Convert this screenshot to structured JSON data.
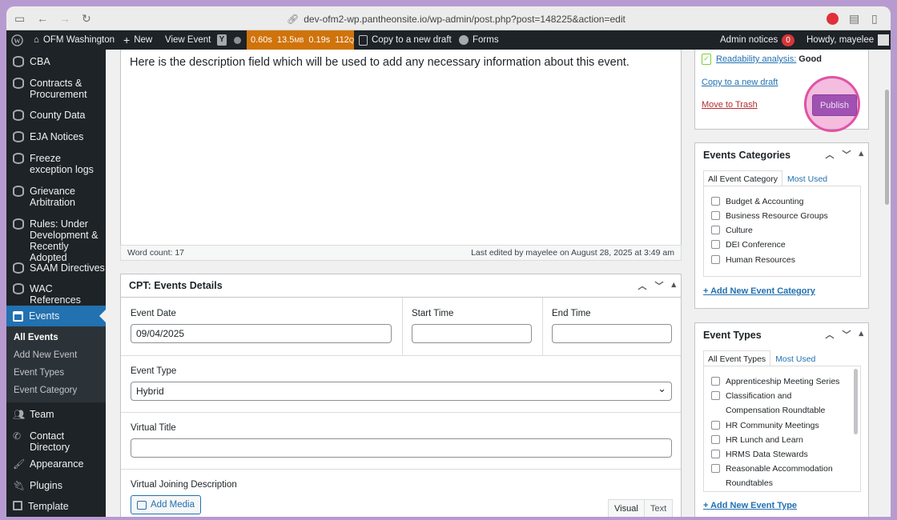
{
  "browser": {
    "url": "dev-ofm2-wp.pantheonsite.io/wp-admin/post.php?post=148225&action=edit"
  },
  "adminbar": {
    "site_name": "OFM Washington",
    "new_label": "New",
    "view_label": "View Event",
    "perf": {
      "time": "0.60s",
      "memory": "13.5",
      "memory_unit": "MB",
      "query_time": "0.19s",
      "queries": "112",
      "queries_unit": "Q"
    },
    "copy_draft": "Copy to a new draft",
    "forms": "Forms",
    "admin_notices": "Admin notices",
    "notice_count": "0",
    "howdy": "Howdy, mayelee"
  },
  "sidebar": {
    "items": [
      {
        "label": "CBA"
      },
      {
        "label": "Contracts & Procurement"
      },
      {
        "label": "County Data"
      },
      {
        "label": "EJA Notices"
      },
      {
        "label": "Freeze exception logs"
      },
      {
        "label": "Grievance Arbitration"
      },
      {
        "label": "Rules: Under Development & Recently Adopted"
      },
      {
        "label": "SAAM Directives"
      },
      {
        "label": "WAC References"
      },
      {
        "label": "Events"
      },
      {
        "label": "Team"
      },
      {
        "label": "Contact Directory"
      },
      {
        "label": "Appearance"
      },
      {
        "label": "Plugins"
      },
      {
        "label": "Template"
      }
    ],
    "submenu": [
      "All Events",
      "Add New Event",
      "Event Types",
      "Event Category"
    ]
  },
  "editor": {
    "description": "Here is the description field which will be used to add any necessary information about this event.",
    "word_count": "Word count: 17",
    "last_edited": "Last edited by mayelee on August 28, 2025 at 3:49 am"
  },
  "cpt_box": {
    "title": "CPT: Events Details",
    "event_date_label": "Event Date",
    "event_date_value": "09/04/2025",
    "start_time_label": "Start Time",
    "end_time_label": "End Time",
    "event_type_label": "Event Type",
    "event_type_value": "Hybrid",
    "virtual_title_label": "Virtual Title",
    "virtual_join_label": "Virtual Joining Description",
    "add_media": "Add Media",
    "tab_visual": "Visual",
    "tab_text": "Text"
  },
  "publish_box": {
    "readability_label": "Readability analysis:",
    "readability_value": "Good",
    "copy_draft": "Copy to a new draft",
    "trash": "Move to Trash",
    "publish": "Publish"
  },
  "categories_box": {
    "title": "Events Categories",
    "tab_all": "All Event Category",
    "tab_most": "Most Used",
    "items": [
      "Budget & Accounting",
      "Business Resource Groups",
      "Culture",
      "DEI Conference",
      "Human Resources"
    ],
    "add_new": "+ Add New Event Category"
  },
  "types_box": {
    "title": "Event Types",
    "tab_all": "All Event Types",
    "tab_most": "Most Used",
    "items": [
      "Apprenticeship Meeting Series",
      "Classification and Compensation Roundtable",
      "HR Community Meetings",
      "HR Lunch and Learn",
      "HRMS Data Stewards",
      "Reasonable Accommodation Roundtables"
    ],
    "add_new": "+ Add New Event Type"
  },
  "colors": {
    "accent": "#2271b1",
    "adminbar": "#1d2327",
    "perf": "#d0730a",
    "publish": "#a052b3",
    "highlight": "#e152a4"
  }
}
